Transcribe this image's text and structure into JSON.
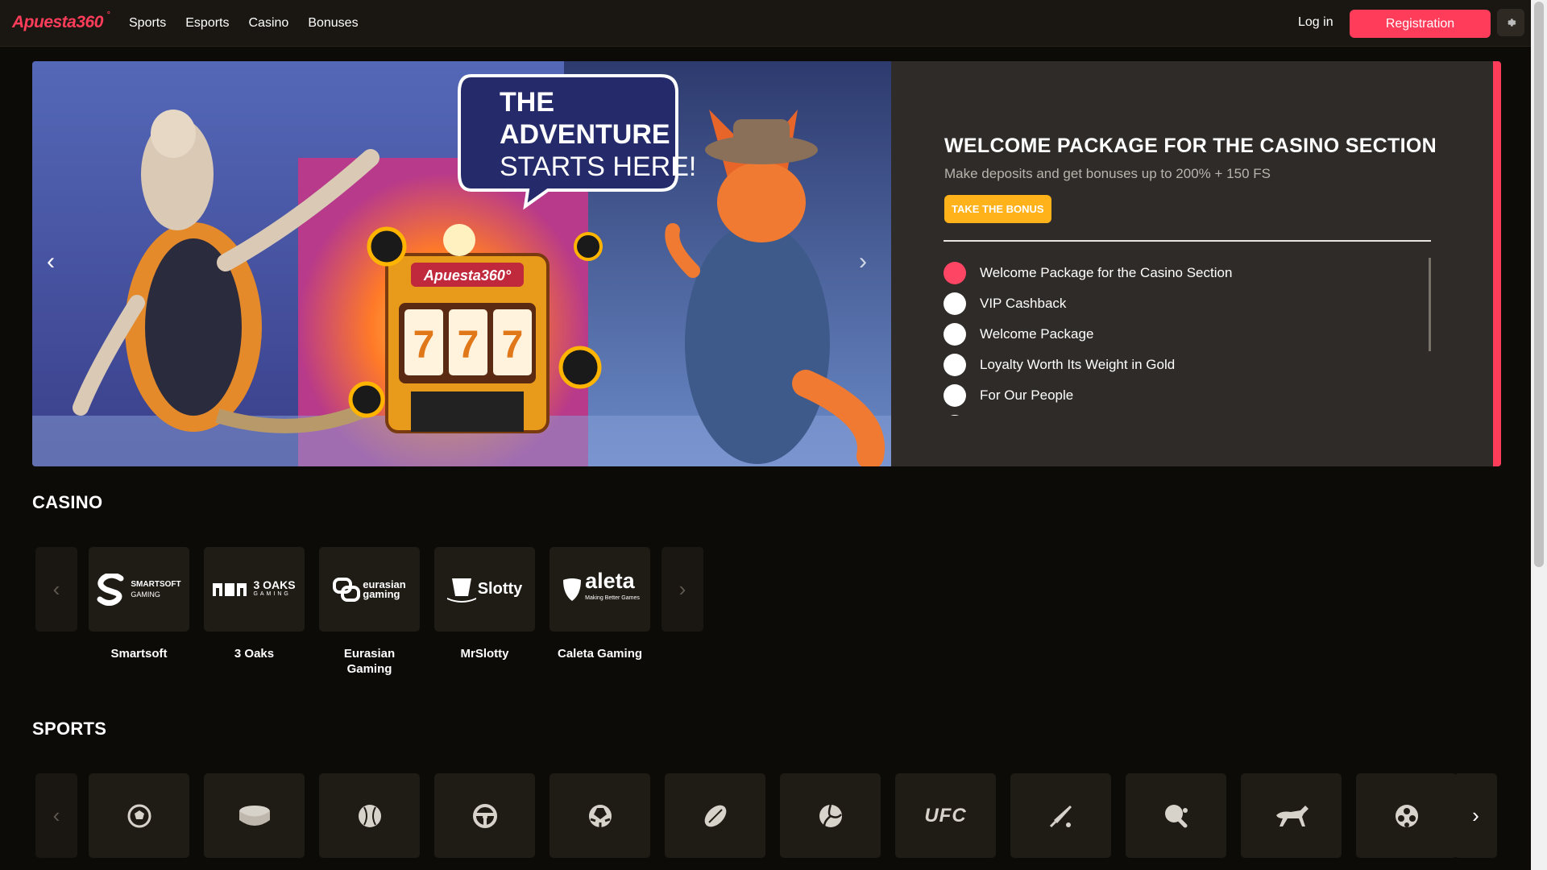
{
  "header": {
    "logo": "Apuesta360",
    "logo_mark": "°",
    "nav": [
      "Sports",
      "Esports",
      "Casino",
      "Bonuses"
    ],
    "login": "Log in",
    "register": "Registration",
    "settings_icon": "gear-icon"
  },
  "banner": {
    "bubble_line1": "THE",
    "bubble_line2": "ADVENTURE",
    "bubble_line3": "STARTS HERE!",
    "slot_brand": "Apuesta360°",
    "slot_reels": [
      "7",
      "7",
      "7"
    ],
    "title": "WELCOME PACKAGE FOR THE CASINO SECTION",
    "subtitle": "Make deposits and get bonuses up to 200% + 150 FS",
    "cta": "TAKE THE BONUS",
    "items": [
      "Welcome Package for the Casino Section",
      "VIP Cashback",
      "Welcome Package",
      "Loyalty Worth Its Weight in Gold",
      "For Our People"
    ],
    "active_index": 0,
    "accent_color": "#ff3c5a"
  },
  "casino": {
    "title": "CASINO",
    "providers": [
      {
        "name": "Smartsoft",
        "logo": "SMARTSOFT",
        "logo_sub": "GAMING"
      },
      {
        "name": "3 Oaks",
        "logo": "3 OAKS",
        "logo_sub": "GAMING"
      },
      {
        "name": "Eurasian Gaming",
        "logo": "eurasian",
        "logo_sub": "gaming"
      },
      {
        "name": "MrSlotty",
        "logo": "Slotty",
        "logo_sub": ""
      },
      {
        "name": "Caleta Gaming",
        "logo": "aleta",
        "logo_sub": "Making Better Games"
      }
    ]
  },
  "sports": {
    "title": "SPORTS",
    "icons": [
      "soccer-icon",
      "hockey-puck-icon",
      "baseball-icon",
      "steering-wheel-icon",
      "soccer-ball-icon",
      "rugby-icon",
      "volleyball-icon",
      "ufc-icon",
      "cricket-icon",
      "table-tennis-icon",
      "horse-racing-icon",
      "futsal-icon"
    ],
    "ufc_label": "UFC"
  }
}
